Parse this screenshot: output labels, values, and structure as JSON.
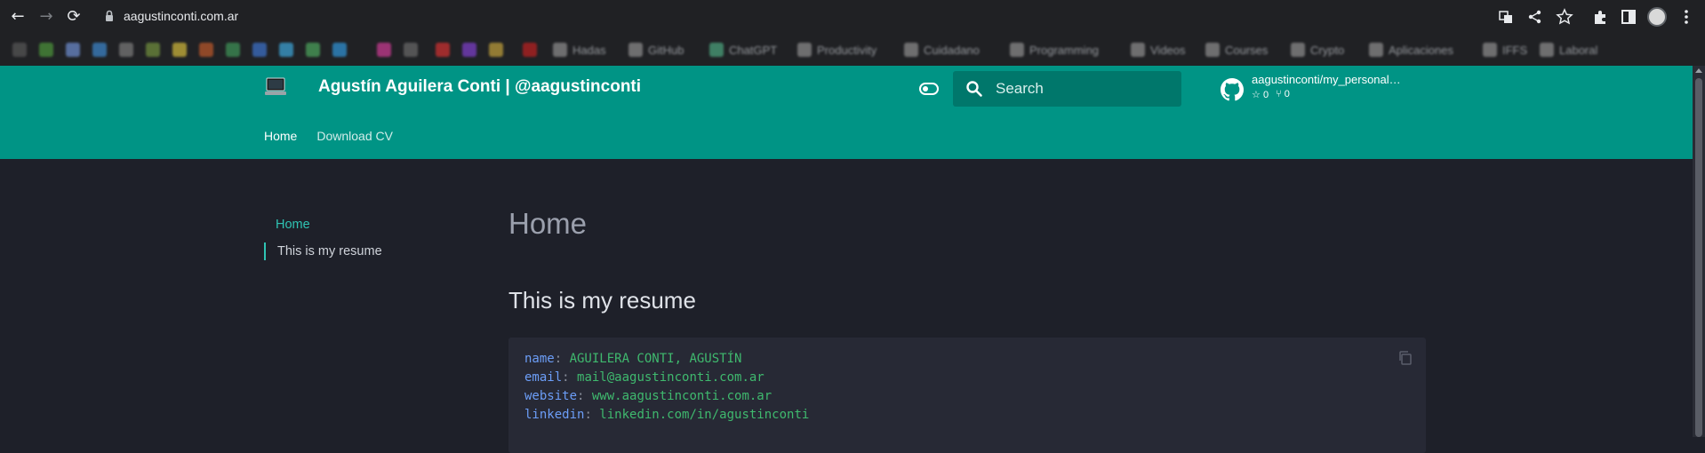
{
  "browser": {
    "url": "aagustinconti.com.ar",
    "nav": {
      "back": "←",
      "forward": "→",
      "reload": "⟳"
    },
    "toolbar_icons": [
      "translate-icon",
      "share-icon",
      "star-icon",
      "extensions-icon",
      "sidepanel-icon",
      "avatar",
      "menu-icon"
    ],
    "bookmarks": [
      "Hadas",
      "GitHub",
      "ChatGPT",
      "Productivity",
      "Cuidadano",
      "Programming",
      "Videos",
      "Courses",
      "Crypto",
      "Aplicaciones",
      "IFFS",
      "Laboral"
    ]
  },
  "site": {
    "title": "Agustín Aguilera Conti | @aagustinconti",
    "search_placeholder": "Search",
    "repo": {
      "name": "aagustinconti/my_personal…",
      "stars": "0",
      "forks": "0"
    },
    "tabs": [
      {
        "label": "Home",
        "active": true
      },
      {
        "label": "Download CV",
        "active": false
      }
    ],
    "accent_color": "#009485"
  },
  "toc": {
    "items": [
      {
        "label": "Home"
      },
      {
        "label": "This is my resume"
      }
    ]
  },
  "content": {
    "h1": "Home",
    "h2": "This is my resume",
    "code": [
      {
        "key": "name",
        "value": "AGUILERA CONTI, AGUSTÍN"
      },
      {
        "key": "email",
        "value": "mail@aagustinconti.com.ar"
      },
      {
        "key": "website",
        "value": "www.aagustinconti.com.ar"
      },
      {
        "key": "linkedin",
        "value": "linkedin.com/in/agustinconti"
      }
    ]
  }
}
